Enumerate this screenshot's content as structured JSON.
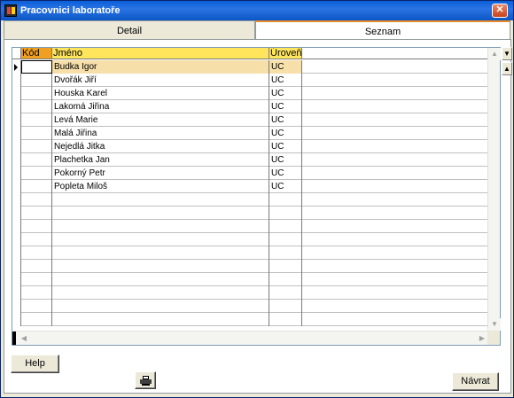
{
  "window": {
    "title": "Pracovnici laboratoře",
    "close_glyph": "✕"
  },
  "tabs": [
    {
      "label": "Detail",
      "active": false
    },
    {
      "label": "Seznam",
      "active": true
    }
  ],
  "grid": {
    "columns": [
      "Kód",
      "Jméno",
      "Úroveň"
    ],
    "rows": [
      {
        "kod": "",
        "jmeno": "Budka Igor",
        "uroven": "UC",
        "selected": true
      },
      {
        "kod": "",
        "jmeno": "Dvořák Jiří",
        "uroven": "UC"
      },
      {
        "kod": "",
        "jmeno": "Houska Karel",
        "uroven": "UC"
      },
      {
        "kod": "",
        "jmeno": "Lakomá Jiřina",
        "uroven": "UC"
      },
      {
        "kod": "",
        "jmeno": "Levá Marie",
        "uroven": "UC"
      },
      {
        "kod": "",
        "jmeno": "Malá Jiřina",
        "uroven": "UC"
      },
      {
        "kod": "",
        "jmeno": "Nejedlá Jitka",
        "uroven": "UC"
      },
      {
        "kod": "",
        "jmeno": "Plachetka Jan",
        "uroven": "UC"
      },
      {
        "kod": "",
        "jmeno": "Pokorný Petr",
        "uroven": "UC"
      },
      {
        "kod": "",
        "jmeno": "Popleta Miloš",
        "uroven": "UC"
      }
    ],
    "empty_rows": 10
  },
  "buttons": {
    "help": "Help",
    "navrat": "Návrat",
    "print_icon": "printer-icon"
  },
  "colors": {
    "header_yellow": "#ffe55c",
    "header_kod": "#f0a020",
    "selected_row": "#f6dfa9",
    "title_bar": "#0a5fd8"
  }
}
